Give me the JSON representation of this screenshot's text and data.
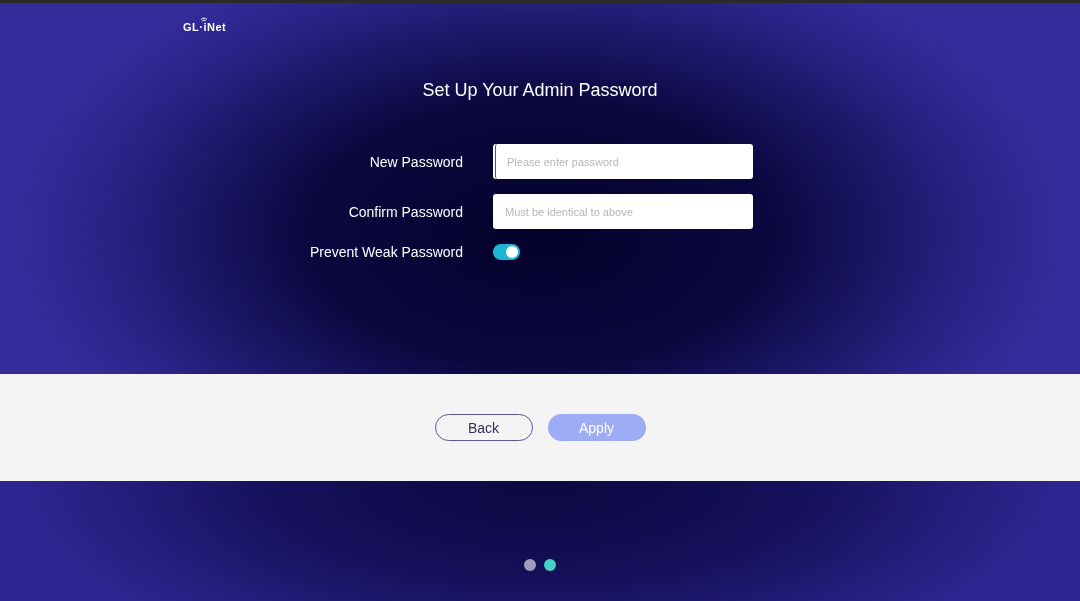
{
  "logo": "GL·iNet",
  "title": "Set Up Your Admin Password",
  "fields": [
    {
      "label": "New Password",
      "placeholder": "Please enter password",
      "focused": true
    },
    {
      "label": "Confirm Password",
      "placeholder": "Must be identical to above",
      "focused": false
    }
  ],
  "toggle": {
    "label": "Prevent Weak Password",
    "on": true
  },
  "buttons": [
    {
      "label": "Back",
      "kind": "outline",
      "disabled": false
    },
    {
      "label": "Apply",
      "kind": "primary",
      "disabled": true
    }
  ],
  "steps": [
    {
      "selected": false
    },
    {
      "selected": true
    }
  ]
}
